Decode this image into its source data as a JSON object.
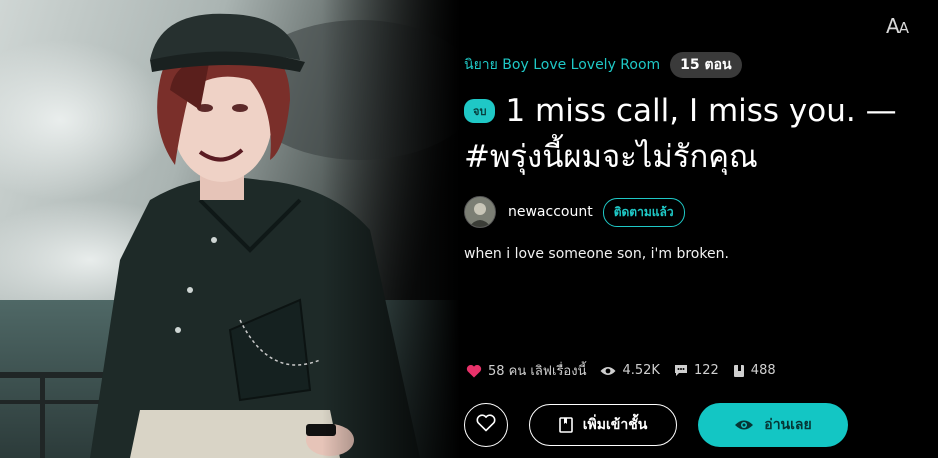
{
  "header": {
    "font_toggle_big": "A",
    "font_toggle_small": "A"
  },
  "novel": {
    "category": "นิยาย Boy Love Lovely Room",
    "episode_count": "15 ตอน",
    "status_badge": "จบ",
    "title": "1 miss call, I miss you. — #พรุ่งนี้ผมจะไม่รักคุณ",
    "author": "newaccount",
    "follow_label": "ติดตามแล้ว",
    "synopsis": "when i love someone son, i'm broken."
  },
  "stats": {
    "likes": "58 คน เลิฟเรื่องนี้",
    "views": "4.52K",
    "comments": "122",
    "library": "488"
  },
  "actions": {
    "add_to_library": "เพิ่มเข้าชั้น",
    "read_now": "อ่านเลย"
  },
  "colors": {
    "accent": "#13c6c4",
    "heart": "#e8326a",
    "background": "#000000"
  },
  "icons": [
    "font-size-icon",
    "heart-icon",
    "eye-icon",
    "comment-icon",
    "book-icon",
    "bookshelf-icon"
  ]
}
